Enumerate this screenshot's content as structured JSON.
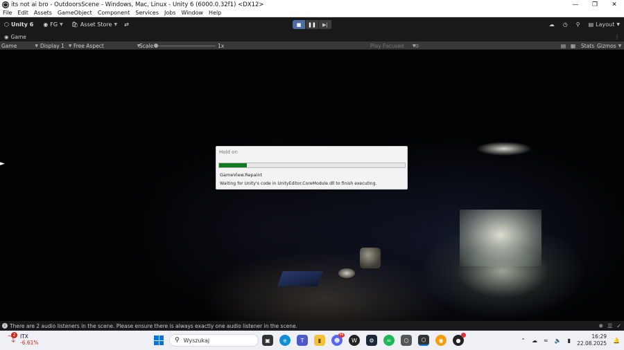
{
  "window": {
    "title": "its not ai bro - OutdoorsScene - Windows, Mac, Linux - Unity 6 (6000.0.32f1) <DX12>",
    "minimize_icon": "minimize-icon",
    "restore_icon": "restore-icon",
    "close_icon": "close-icon"
  },
  "menu": [
    "File",
    "Edit",
    "Assets",
    "GameObject",
    "Component",
    "Services",
    "Jobs",
    "Window",
    "Help"
  ],
  "toolbar": {
    "unity_label": "Unity 6",
    "account_label": "FG",
    "asset_store_label": "Asset Store",
    "layout_label": "Layout"
  },
  "tab": {
    "label": "Game"
  },
  "gamebar": {
    "game_dropdown": "Game",
    "display_dropdown": "Display 1",
    "aspect_dropdown": "Free Aspect",
    "scale_label": "Scale",
    "scale_value": "1x",
    "scale_fraction": 0.0,
    "play_focused": "Play Focused",
    "stats_label": "Stats",
    "gizmos_label": "Gizmos"
  },
  "dialog": {
    "title": "Hold on",
    "progress": 0.15,
    "step": "GameView.Repaint",
    "message": "Waiting for Unity's code in UnityEditor.CoreModule.dll to finish executing."
  },
  "status": {
    "message": "There are 2 audio listeners in the scene. Please ensure there is always exactly one audio listener in the scene."
  },
  "taskbar": {
    "stock_name": "ITX",
    "stock_change": "-6.61%",
    "stock_badge": "2",
    "search_placeholder": "Wyszukaj",
    "discord_badge": "99",
    "time": "16:29",
    "date": "22.08.2025"
  },
  "colors": {
    "editor_bg": "#191919",
    "progress_fill": "#0f7a1f",
    "dialog_bg": "#f3f3f3",
    "taskbar_bg": "#eef0f6"
  }
}
